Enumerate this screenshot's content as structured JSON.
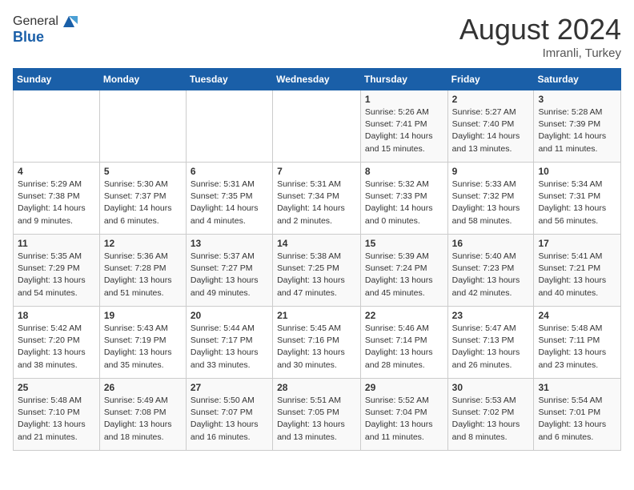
{
  "logo": {
    "general": "General",
    "blue": "Blue"
  },
  "header": {
    "month": "August 2024",
    "location": "Imranli, Turkey"
  },
  "weekdays": [
    "Sunday",
    "Monday",
    "Tuesday",
    "Wednesday",
    "Thursday",
    "Friday",
    "Saturday"
  ],
  "weeks": [
    [
      {
        "day": "",
        "info": ""
      },
      {
        "day": "",
        "info": ""
      },
      {
        "day": "",
        "info": ""
      },
      {
        "day": "",
        "info": ""
      },
      {
        "day": "1",
        "info": "Sunrise: 5:26 AM\nSunset: 7:41 PM\nDaylight: 14 hours\nand 15 minutes."
      },
      {
        "day": "2",
        "info": "Sunrise: 5:27 AM\nSunset: 7:40 PM\nDaylight: 14 hours\nand 13 minutes."
      },
      {
        "day": "3",
        "info": "Sunrise: 5:28 AM\nSunset: 7:39 PM\nDaylight: 14 hours\nand 11 minutes."
      }
    ],
    [
      {
        "day": "4",
        "info": "Sunrise: 5:29 AM\nSunset: 7:38 PM\nDaylight: 14 hours\nand 9 minutes."
      },
      {
        "day": "5",
        "info": "Sunrise: 5:30 AM\nSunset: 7:37 PM\nDaylight: 14 hours\nand 6 minutes."
      },
      {
        "day": "6",
        "info": "Sunrise: 5:31 AM\nSunset: 7:35 PM\nDaylight: 14 hours\nand 4 minutes."
      },
      {
        "day": "7",
        "info": "Sunrise: 5:31 AM\nSunset: 7:34 PM\nDaylight: 14 hours\nand 2 minutes."
      },
      {
        "day": "8",
        "info": "Sunrise: 5:32 AM\nSunset: 7:33 PM\nDaylight: 14 hours\nand 0 minutes."
      },
      {
        "day": "9",
        "info": "Sunrise: 5:33 AM\nSunset: 7:32 PM\nDaylight: 13 hours\nand 58 minutes."
      },
      {
        "day": "10",
        "info": "Sunrise: 5:34 AM\nSunset: 7:31 PM\nDaylight: 13 hours\nand 56 minutes."
      }
    ],
    [
      {
        "day": "11",
        "info": "Sunrise: 5:35 AM\nSunset: 7:29 PM\nDaylight: 13 hours\nand 54 minutes."
      },
      {
        "day": "12",
        "info": "Sunrise: 5:36 AM\nSunset: 7:28 PM\nDaylight: 13 hours\nand 51 minutes."
      },
      {
        "day": "13",
        "info": "Sunrise: 5:37 AM\nSunset: 7:27 PM\nDaylight: 13 hours\nand 49 minutes."
      },
      {
        "day": "14",
        "info": "Sunrise: 5:38 AM\nSunset: 7:25 PM\nDaylight: 13 hours\nand 47 minutes."
      },
      {
        "day": "15",
        "info": "Sunrise: 5:39 AM\nSunset: 7:24 PM\nDaylight: 13 hours\nand 45 minutes."
      },
      {
        "day": "16",
        "info": "Sunrise: 5:40 AM\nSunset: 7:23 PM\nDaylight: 13 hours\nand 42 minutes."
      },
      {
        "day": "17",
        "info": "Sunrise: 5:41 AM\nSunset: 7:21 PM\nDaylight: 13 hours\nand 40 minutes."
      }
    ],
    [
      {
        "day": "18",
        "info": "Sunrise: 5:42 AM\nSunset: 7:20 PM\nDaylight: 13 hours\nand 38 minutes."
      },
      {
        "day": "19",
        "info": "Sunrise: 5:43 AM\nSunset: 7:19 PM\nDaylight: 13 hours\nand 35 minutes."
      },
      {
        "day": "20",
        "info": "Sunrise: 5:44 AM\nSunset: 7:17 PM\nDaylight: 13 hours\nand 33 minutes."
      },
      {
        "day": "21",
        "info": "Sunrise: 5:45 AM\nSunset: 7:16 PM\nDaylight: 13 hours\nand 30 minutes."
      },
      {
        "day": "22",
        "info": "Sunrise: 5:46 AM\nSunset: 7:14 PM\nDaylight: 13 hours\nand 28 minutes."
      },
      {
        "day": "23",
        "info": "Sunrise: 5:47 AM\nSunset: 7:13 PM\nDaylight: 13 hours\nand 26 minutes."
      },
      {
        "day": "24",
        "info": "Sunrise: 5:48 AM\nSunset: 7:11 PM\nDaylight: 13 hours\nand 23 minutes."
      }
    ],
    [
      {
        "day": "25",
        "info": "Sunrise: 5:48 AM\nSunset: 7:10 PM\nDaylight: 13 hours\nand 21 minutes."
      },
      {
        "day": "26",
        "info": "Sunrise: 5:49 AM\nSunset: 7:08 PM\nDaylight: 13 hours\nand 18 minutes."
      },
      {
        "day": "27",
        "info": "Sunrise: 5:50 AM\nSunset: 7:07 PM\nDaylight: 13 hours\nand 16 minutes."
      },
      {
        "day": "28",
        "info": "Sunrise: 5:51 AM\nSunset: 7:05 PM\nDaylight: 13 hours\nand 13 minutes."
      },
      {
        "day": "29",
        "info": "Sunrise: 5:52 AM\nSunset: 7:04 PM\nDaylight: 13 hours\nand 11 minutes."
      },
      {
        "day": "30",
        "info": "Sunrise: 5:53 AM\nSunset: 7:02 PM\nDaylight: 13 hours\nand 8 minutes."
      },
      {
        "day": "31",
        "info": "Sunrise: 5:54 AM\nSunset: 7:01 PM\nDaylight: 13 hours\nand 6 minutes."
      }
    ]
  ]
}
